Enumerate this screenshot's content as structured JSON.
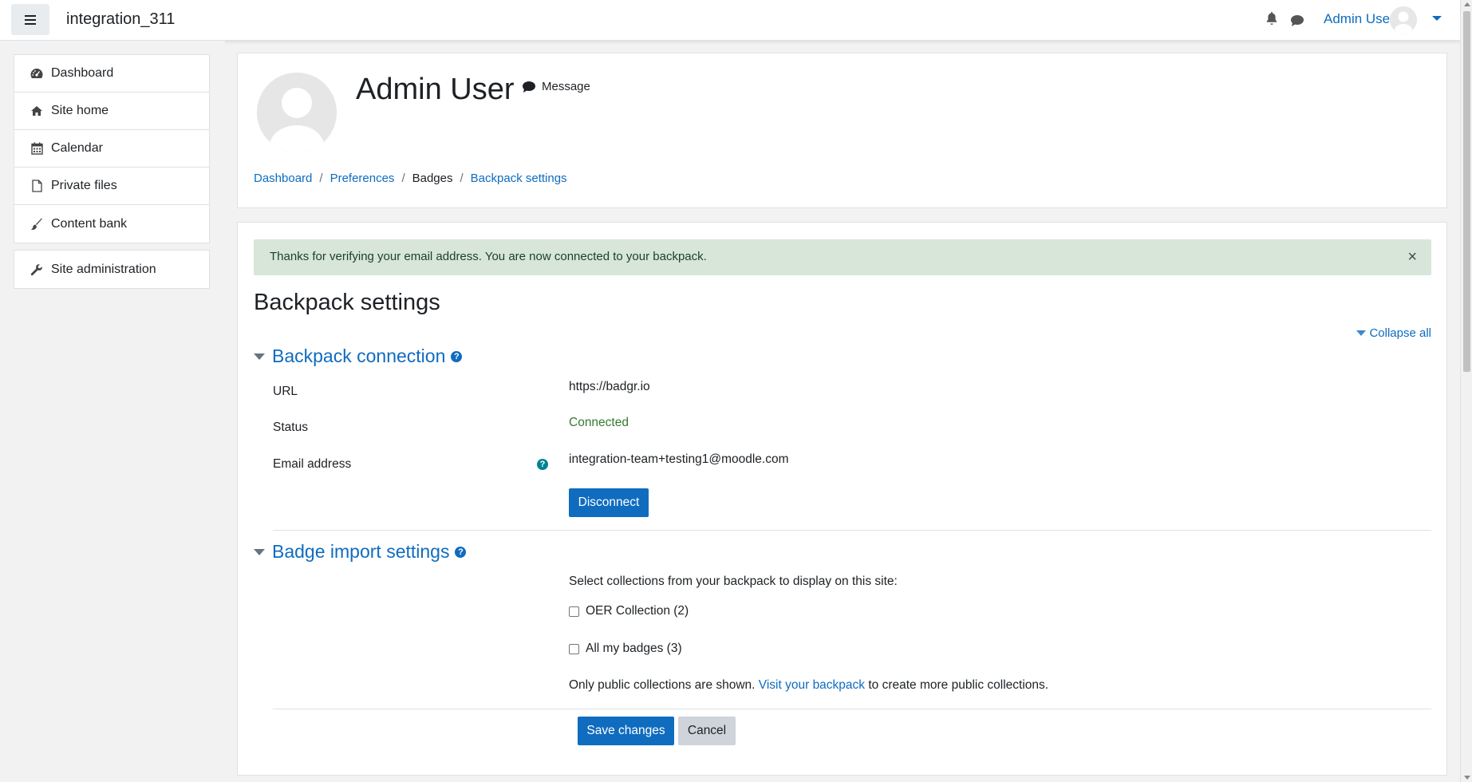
{
  "topbar": {
    "site_name": "integration_311",
    "user_name": "Admin User"
  },
  "drawer": {
    "items": [
      {
        "label": "Dashboard",
        "icon": "dashboard-icon"
      },
      {
        "label": "Site home",
        "icon": "home-icon"
      },
      {
        "label": "Calendar",
        "icon": "calendar-icon"
      },
      {
        "label": "Private files",
        "icon": "file-icon"
      },
      {
        "label": "Content bank",
        "icon": "brush-icon"
      }
    ],
    "admin": {
      "label": "Site administration",
      "icon": "wrench-icon"
    }
  },
  "header": {
    "name": "Admin User",
    "message_label": "Message",
    "breadcrumb": [
      "Dashboard",
      "Preferences",
      "Badges",
      "Backpack settings"
    ]
  },
  "alert": {
    "text": "Thanks for verifying your email address. You are now connected to your backpack.",
    "close": "×"
  },
  "page": {
    "title": "Backpack settings",
    "collapse_all": "Collapse all"
  },
  "connection": {
    "title": "Backpack connection",
    "url_label": "URL",
    "url_value": "https://badgr.io",
    "status_label": "Status",
    "status_value": "Connected",
    "email_label": "Email address",
    "email_value": "integration-team+testing1@moodle.com",
    "disconnect": "Disconnect"
  },
  "import": {
    "title": "Badge import settings",
    "intro": "Select collections from your backpack to display on this site:",
    "collections": [
      "OER Collection (2)",
      "All my badges (3)"
    ],
    "note_before": "Only public collections are shown.",
    "note_link": "Visit your backpack",
    "note_after": "to create more public collections."
  },
  "buttons": {
    "save": "Save changes",
    "cancel": "Cancel"
  },
  "colors": {
    "primary": "#0f6cbf",
    "success_bg": "#d7e6d9",
    "connected": "#357a32"
  }
}
